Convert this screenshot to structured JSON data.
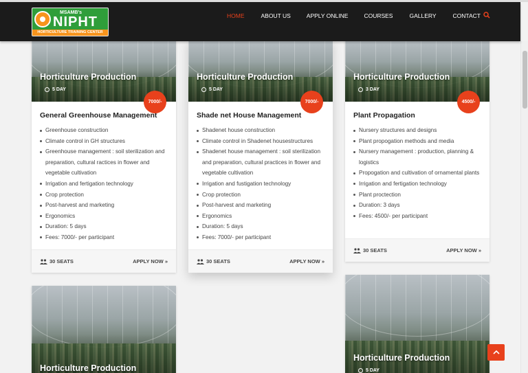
{
  "header": {
    "logo": {
      "top_text": "MSAMB's",
      "main_text": "NIPHT",
      "sub_text": "HORTICULTURE TRAINING CENTER"
    },
    "nav": [
      {
        "label": "HOME",
        "active": true
      },
      {
        "label": "ABOUT US",
        "active": false
      },
      {
        "label": "APPLY ONLINE",
        "active": false
      },
      {
        "label": "COURSES",
        "active": false
      },
      {
        "label": "GALLERY",
        "active": false
      },
      {
        "label": "CONTACT",
        "active": false
      }
    ],
    "search_icon": "search-icon"
  },
  "colors": {
    "accent": "#e8411c",
    "nav_bg": "#1b1b1b",
    "logo_green": "#2f9e3a",
    "logo_orange": "#f7941d"
  },
  "cards": [
    {
      "category": "Horticulture Production",
      "duration": "5 DAY",
      "price": "7000/-",
      "title": "General Greenhouse Management",
      "items": [
        "Greenhouse construction",
        "Climate control in GH structures",
        "Greenhouse management : soil sterilization and preparation, cultural ractices in flower and vegetable cultivation",
        "Irrigation and fertigation technology",
        "Crop protection",
        "Post-harvest and marketing",
        "Ergonomics",
        "Duration: 5 days",
        "Fees: 7000/- per participant"
      ],
      "seats": "30 SEATS",
      "apply": "APPLY NOW »"
    },
    {
      "category": "Horticulture Production",
      "duration": "5 DAY",
      "price": "7000/-",
      "title": "Shade net House Management",
      "items": [
        "Shadenet house construction",
        "Climate control in Shadenet housestructures",
        "Shadenet house management : soil sterilization and preparation, cultural practices in flower and vegetable cultivation",
        "Irrigation and fustigation technology",
        "Crop protection",
        "Post-harvest and marketing",
        "Ergonomics",
        "Duration: 5 days",
        "Fees: 7000/- per participant"
      ],
      "seats": "30 SEATS",
      "apply": "APPLY NOW »"
    },
    {
      "category": "Horticulture Production",
      "duration": "3 DAY",
      "price": "4500/-",
      "title": "Plant Propagation",
      "items": [
        "Nursery structures and designs",
        "Plant propogation methods and media",
        "Nursery management : production, planning & logistics",
        "Propogation and cultivation of ornamental plants",
        "Irrigation and fertigation technology",
        "Plant proctection",
        "Duration: 3 days",
        "Fees: 4500/- per participant"
      ],
      "seats": "30 SEATS",
      "apply": "APPLY NOW »"
    },
    {
      "category": "Horticulture Production"
    },
    {
      "category": "Horticulture Production",
      "duration": "5 DAY"
    }
  ]
}
